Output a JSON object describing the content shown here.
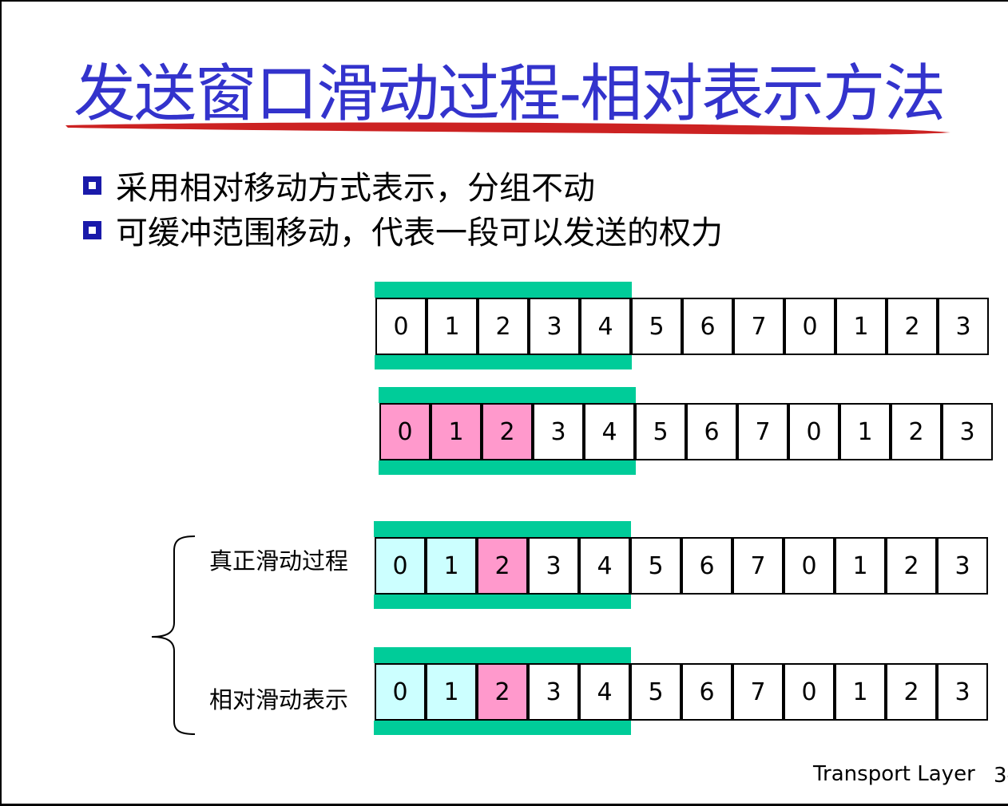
{
  "title": "发送窗口滑动过程-相对表示方法",
  "bullets": [
    "采用相对移动方式表示，分组不动",
    "可缓冲范围移动，代表一段可以发送的权力"
  ],
  "rows": [
    {
      "label": "",
      "cells": [
        "0",
        "1",
        "2",
        "3",
        "4",
        "5",
        "6",
        "7",
        "0",
        "1",
        "2",
        "3"
      ],
      "states": [
        "none",
        "none",
        "none",
        "none",
        "none",
        "none",
        "none",
        "none",
        "none",
        "none",
        "none",
        "none"
      ],
      "window_start": 0,
      "window_size": 5
    },
    {
      "label": "",
      "cells": [
        "0",
        "1",
        "2",
        "3",
        "4",
        "5",
        "6",
        "7",
        "0",
        "1",
        "2",
        "3"
      ],
      "states": [
        "sent-unacked",
        "sent-unacked",
        "sent-unacked",
        "none",
        "none",
        "none",
        "none",
        "none",
        "none",
        "none",
        "none",
        "none"
      ],
      "window_start": 0,
      "window_size": 5
    },
    {
      "label": "真正滑动过程",
      "cells": [
        "0",
        "1",
        "2",
        "3",
        "4",
        "5",
        "6",
        "7",
        "0",
        "1",
        "2",
        "3"
      ],
      "states": [
        "sent-acked",
        "sent-acked",
        "sent-unacked",
        "none",
        "none",
        "none",
        "none",
        "none",
        "none",
        "none",
        "none",
        "none"
      ],
      "window_start": 0,
      "window_size": 5
    },
    {
      "label": "相对滑动表示",
      "cells": [
        "0",
        "1",
        "2",
        "3",
        "4",
        "5",
        "6",
        "7",
        "0",
        "1",
        "2",
        "3"
      ],
      "states": [
        "sent-acked",
        "sent-acked",
        "sent-unacked",
        "none",
        "none",
        "none",
        "none",
        "none",
        "none",
        "none",
        "none",
        "none"
      ],
      "window_start": 0,
      "window_size": 5
    }
  ],
  "colors": {
    "title": "#3333cc",
    "bullet_marker": "#1a1aaa",
    "window_bar": "#00cc99",
    "sent_acked": "#ccffff",
    "sent_unacked": "#ff99cc",
    "underline": "#cc2222"
  },
  "footer": {
    "text": "Transport Layer",
    "page": "3-"
  }
}
